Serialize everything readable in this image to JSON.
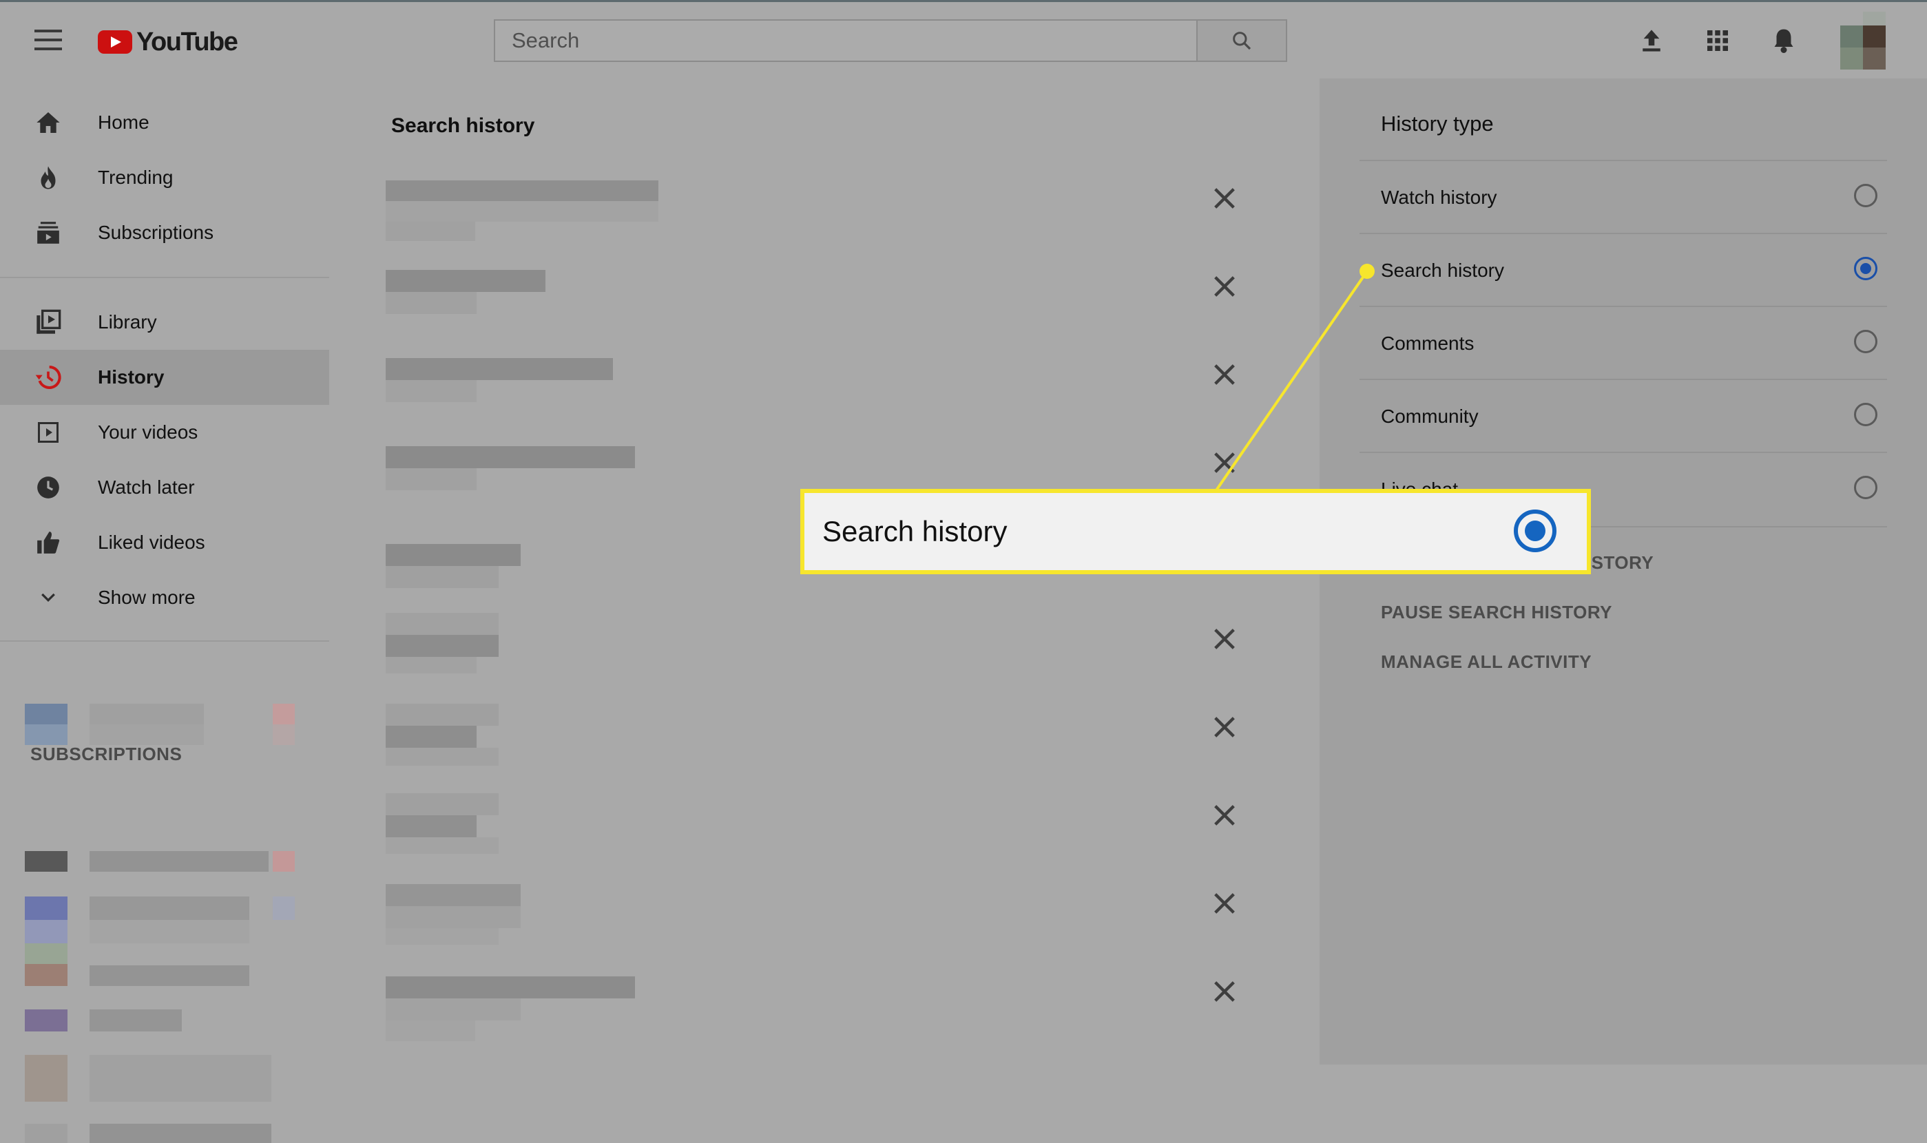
{
  "app": {
    "logo_text": "YouTube"
  },
  "search": {
    "placeholder": "Search"
  },
  "masthead_icons": [
    "upload-icon",
    "apps-grid-icon",
    "notifications-bell-icon"
  ],
  "sidebar": {
    "items": [
      {
        "label": "Home",
        "icon": "home-icon"
      },
      {
        "label": "Trending",
        "icon": "fire-icon"
      },
      {
        "label": "Subscriptions",
        "icon": "subscriptions-icon"
      },
      {
        "label": "Library",
        "icon": "library-icon"
      },
      {
        "label": "History",
        "icon": "history-icon",
        "active": true
      },
      {
        "label": "Your videos",
        "icon": "play-square-icon"
      },
      {
        "label": "Watch later",
        "icon": "clock-icon"
      },
      {
        "label": "Liked videos",
        "icon": "thumbs-up-icon"
      },
      {
        "label": "Show more",
        "icon": "chevron-down-icon"
      }
    ],
    "subscriptions_heading": "SUBSCRIPTIONS"
  },
  "main": {
    "title": "Search history",
    "removed_entries_note": "entries are pixelated/blurred"
  },
  "history_type": {
    "title": "History type",
    "options": [
      {
        "label": "Watch history",
        "selected": false
      },
      {
        "label": "Search history",
        "selected": true
      },
      {
        "label": "Comments",
        "selected": false
      },
      {
        "label": "Community",
        "selected": false
      },
      {
        "label": "Live chat",
        "selected": false
      }
    ],
    "actions": [
      "CLEAR ALL SEARCH HISTORY",
      "PAUSE SEARCH HISTORY",
      "MANAGE ALL ACTIVITY"
    ]
  },
  "callout": {
    "label": "Search history",
    "selected": true
  },
  "colors": {
    "accent": "#cc1010",
    "radio_selected": "#1565c0",
    "callout_border": "#f7e62d"
  }
}
